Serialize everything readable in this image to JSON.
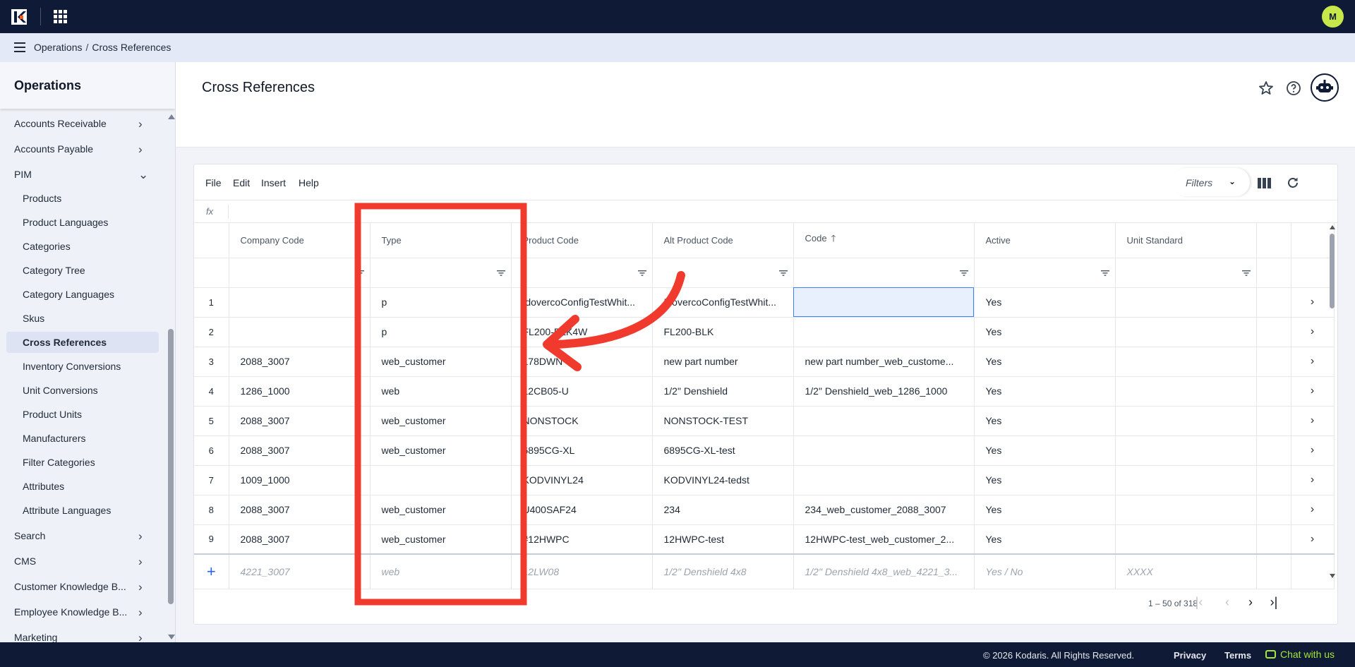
{
  "topbar": {
    "avatar_initial": "M"
  },
  "breadcrumb": [
    "Operations",
    "Cross References"
  ],
  "sidebar": {
    "title": "Operations",
    "items": [
      {
        "label": "Accounts Receivable",
        "level": "top",
        "chevron": "›"
      },
      {
        "label": "Accounts Payable",
        "level": "top",
        "chevron": "›"
      },
      {
        "label": "PIM",
        "level": "top",
        "chevron": "⌄"
      },
      {
        "label": "Products",
        "level": "sub"
      },
      {
        "label": "Product Languages",
        "level": "sub"
      },
      {
        "label": "Categories",
        "level": "sub"
      },
      {
        "label": "Category Tree",
        "level": "sub"
      },
      {
        "label": "Category Languages",
        "level": "sub"
      },
      {
        "label": "Skus",
        "level": "sub"
      },
      {
        "label": "Cross References",
        "level": "sub",
        "active": true
      },
      {
        "label": "Inventory Conversions",
        "level": "sub"
      },
      {
        "label": "Unit Conversions",
        "level": "sub"
      },
      {
        "label": "Product Units",
        "level": "sub"
      },
      {
        "label": "Manufacturers",
        "level": "sub"
      },
      {
        "label": "Filter Categories",
        "level": "sub"
      },
      {
        "label": "Attributes",
        "level": "sub"
      },
      {
        "label": "Attribute Languages",
        "level": "sub"
      },
      {
        "label": "Search",
        "level": "top",
        "chevron": "›"
      },
      {
        "label": "CMS",
        "level": "top",
        "chevron": "›"
      },
      {
        "label": "Customer Knowledge B...",
        "level": "top",
        "chevron": "›"
      },
      {
        "label": "Employee Knowledge B...",
        "level": "top",
        "chevron": "›"
      },
      {
        "label": "Marketing",
        "level": "top",
        "chevron": "›"
      }
    ]
  },
  "page": {
    "title": "Cross References"
  },
  "toolbar": {
    "menu": [
      "File",
      "Edit",
      "Insert",
      "Help"
    ],
    "filters_label": "Filters",
    "fx_label": "fx"
  },
  "grid": {
    "columns": [
      "Company Code",
      "Type",
      "Product Code",
      "Alt Product Code",
      "Code",
      "Active",
      "Unit Standard"
    ],
    "sorted_column": "Code",
    "rows": [
      {
        "n": "1",
        "company": "",
        "type": "p",
        "product": "IdovercoConfigTestWhit...",
        "alt": "IdovercoConfigTestWhit...",
        "code": "",
        "active": "Yes",
        "unit": ""
      },
      {
        "n": "2",
        "company": "",
        "type": "p",
        "product": "FL200-BLK4W",
        "alt": "FL200-BLK",
        "code": "",
        "active": "Yes",
        "unit": ""
      },
      {
        "n": "3",
        "company": "2088_3007",
        "type": "web_customer",
        "product": "178DWN",
        "alt": "new part number",
        "code": "new part number_web_custome...",
        "active": "Yes",
        "unit": ""
      },
      {
        "n": "4",
        "company": "1286_1000",
        "type": "web",
        "product": "12CB05-U",
        "alt": "1/2\" Denshield",
        "code": "1/2\" Denshield_web_1286_1000",
        "active": "Yes",
        "unit": ""
      },
      {
        "n": "5",
        "company": "2088_3007",
        "type": "web_customer",
        "product": "NONSTOCK",
        "alt": "NONSTOCK-TEST",
        "code": "",
        "active": "Yes",
        "unit": ""
      },
      {
        "n": "6",
        "company": "2088_3007",
        "type": "web_customer",
        "product": "6895CG-XL",
        "alt": "6895CG-XL-test",
        "code": "",
        "active": "Yes",
        "unit": ""
      },
      {
        "n": "7",
        "company": "1009_1000",
        "type": "",
        "product": "KODVINYL24",
        "alt": "KODVINYL24-tedst",
        "code": "",
        "active": "Yes",
        "unit": ""
      },
      {
        "n": "8",
        "company": "2088_3007",
        "type": "web_customer",
        "product": "U400SAF24",
        "alt": "234",
        "code": "234_web_customer_2088_3007",
        "active": "Yes",
        "unit": ""
      },
      {
        "n": "9",
        "company": "2088_3007",
        "type": "web_customer",
        "product": "#12HWPC",
        "alt": "12HWPC-test",
        "code": "12HWPC-test_web_customer_2...",
        "active": "Yes",
        "unit": ""
      }
    ],
    "new_row_placeholders": {
      "company": "4221_3007",
      "type": "web",
      "product": "12LW08",
      "alt": "1/2\" Denshield 4x8",
      "code": "1/2\" Denshield 4x8_web_4221_3...",
      "active": "Yes / No",
      "unit": "XXXX"
    }
  },
  "pagination": {
    "range": "1 – 50 of 318"
  },
  "footer": {
    "copyright": "© 2026 Kodaris. All Rights Reserved.",
    "privacy": "Privacy",
    "terms": "Terms",
    "chat": "Chat with us"
  },
  "colors": {
    "topbar": "#0f1a36",
    "accent": "#c6e84a",
    "annotation": "#f03a2e"
  }
}
